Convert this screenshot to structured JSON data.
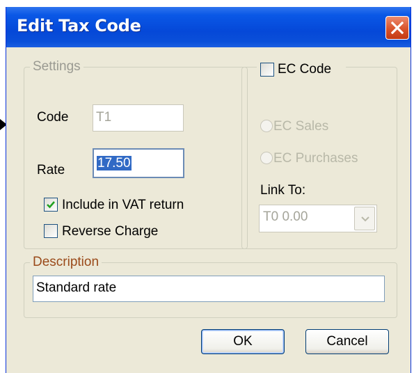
{
  "dialog": {
    "title": "Edit Tax Code",
    "close_icon": "close-icon"
  },
  "settings": {
    "group_label": "Settings",
    "code_label": "Code",
    "code_value": "T1",
    "rate_label": "Rate",
    "rate_value": "17.50",
    "include_vat_label": "Include in VAT return",
    "include_vat_checked": true,
    "reverse_charge_label": "Reverse Charge",
    "reverse_charge_checked": false
  },
  "ec": {
    "ec_code_label": "EC Code",
    "ec_code_checked": false,
    "ec_sales_label": "EC Sales",
    "ec_purchases_label": "EC Purchases",
    "link_to_label": "Link To:",
    "link_to_value": "T0  0.00"
  },
  "description": {
    "group_label": "Description",
    "value": "Standard rate"
  },
  "buttons": {
    "ok_label": "OK",
    "cancel_label": "Cancel"
  },
  "colors": {
    "title_bar": "#0548d8",
    "window_face": "#ece9d8",
    "close_button": "#d9532b",
    "selection": "#316ac5",
    "check_mark": "#21a121"
  }
}
